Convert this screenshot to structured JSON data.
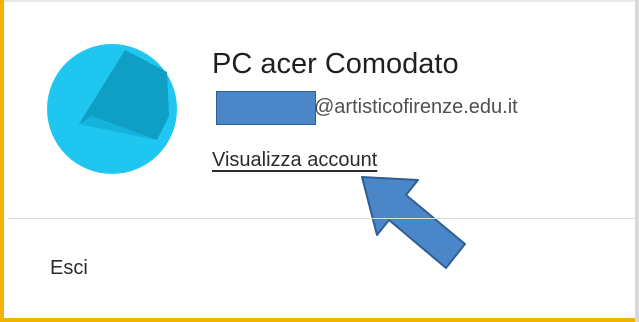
{
  "account": {
    "name": "PC acer Comodato",
    "email_domain": "@artisticofirenze.edu.it",
    "view_account_label": "Visualizza account"
  },
  "menu": {
    "sign_out_label": "Esci"
  },
  "colors": {
    "accent_border": "#f0b400",
    "avatar_light": "#1ec6f0",
    "avatar_dark": "#0f9ec4",
    "annotation_arrow": "#4a86c8"
  },
  "icons": {
    "avatar": "avatar-icon",
    "annotation": "arrow-annotation-icon"
  }
}
